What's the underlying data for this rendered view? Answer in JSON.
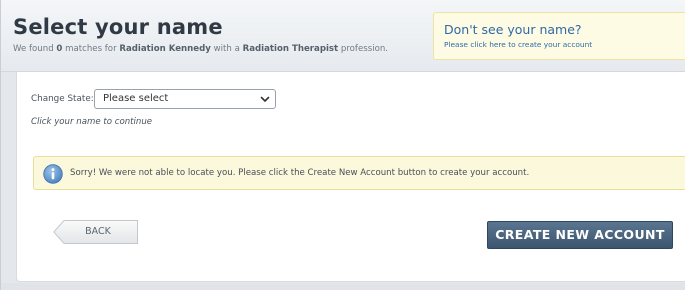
{
  "header": {
    "title": "Select your name",
    "subtitle": {
      "prefix": "We found ",
      "count": "0",
      "middle1": " matches for ",
      "name": "Radiation Kennedy",
      "middle2": " with a ",
      "profession": "Radiation Therapist",
      "suffix": " profession."
    }
  },
  "notice": {
    "title": "Don't see your name?",
    "link": "Please click here to create your account"
  },
  "form": {
    "state_label": "Change State:",
    "state_selected": "Please select",
    "hint": "Click your name to continue"
  },
  "alert": {
    "icon": "info-icon",
    "text": "Sorry! We were not able to locate you. Please click the Create New Account button to create your account."
  },
  "buttons": {
    "back": "BACK",
    "create": "CREATE NEW ACCOUNT"
  },
  "colors": {
    "accent_blue": "#2f6aa6",
    "button_dark": "#3d566f",
    "alert_bg": "#fbf8dc",
    "info_icon": "#6a9ed0"
  }
}
